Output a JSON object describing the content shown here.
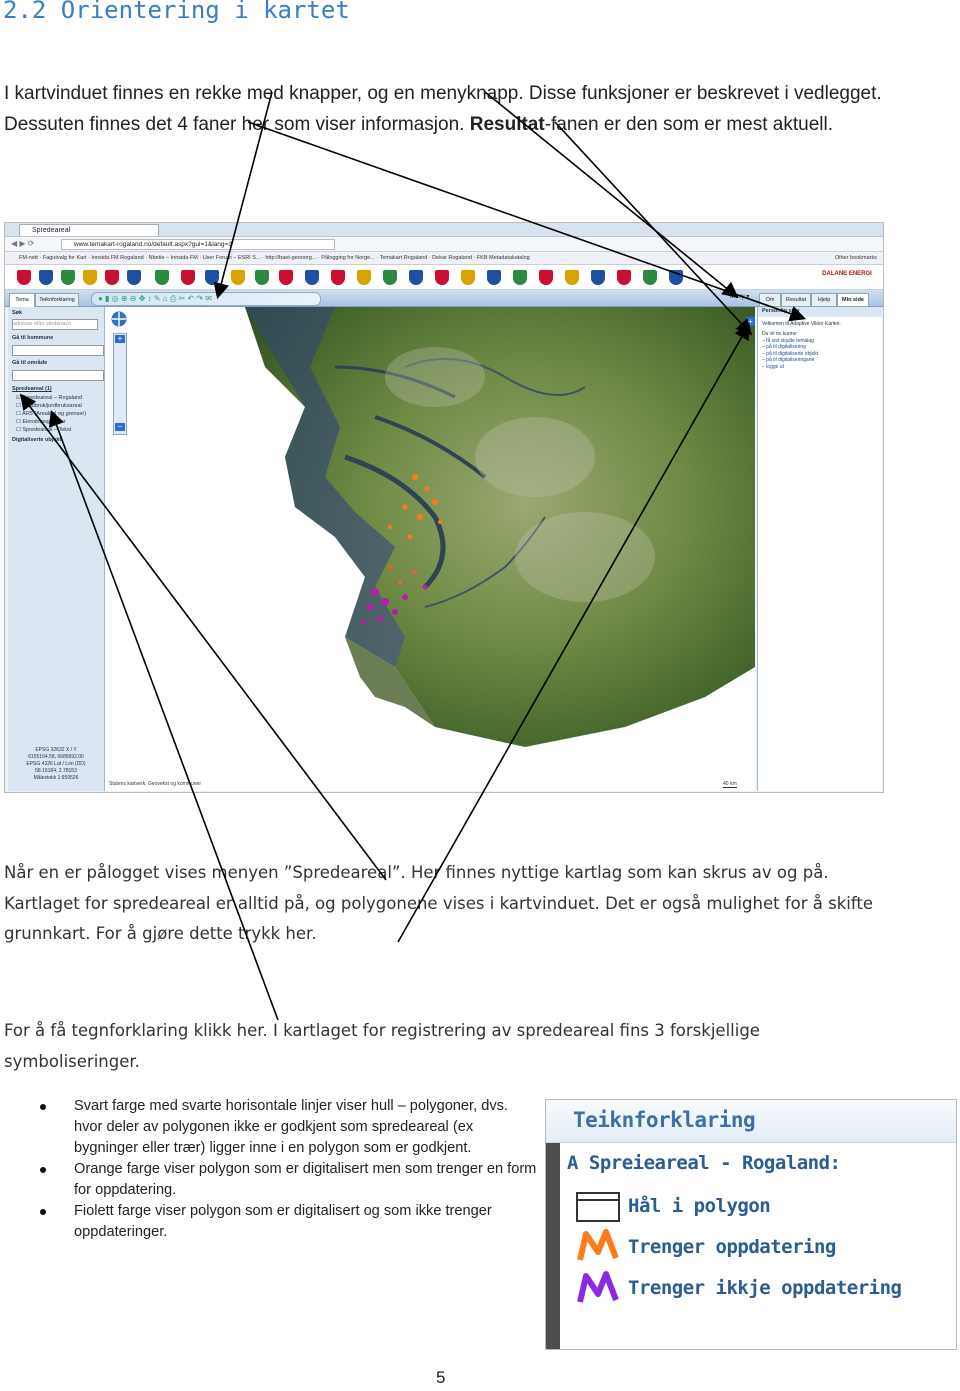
{
  "heading": "2.2 Orientering i kartet",
  "intro": {
    "part1": "I kartvinduet finnes en rekke med knapper, og en menyknapp. Disse funksjoner er beskrevet i vedlegget. Dessuten finnes det 4 faner her som viser informasjon. ",
    "bold": "Resultat",
    "part2": "-fanen er den som er mest aktuell."
  },
  "screenshot": {
    "tab_title": "Spredeareal",
    "url": "www.temakart-rogaland.no/default.aspx?gui=1&lang=3",
    "bookmarks": "FM-nett · Fagutvalg for Kart · Innsida FM Rogaland · Nbetie – Innsida FM · User Forum – ESRI S... · http://baet-geonorg... · Pålogging for Norge... · Temakart Rogaland · Dekar Rogaland · FKB Metadatakatalog",
    "other_bookmarks": "Other bookmarks",
    "left_tabs": [
      "Tema",
      "Teiknforklaring"
    ],
    "sidebar": {
      "search_label": "Søk",
      "search_placeholder": "adresse eller stedsnavn",
      "go_municipality": "Gå til kommune",
      "go_place": "Gå til område",
      "spreadarea_title": "Spredeareal (1)",
      "layers": [
        "Spredeareal – Rogaland",
        "Landbruk/jordbruksareal",
        "AR5 (Arealdel og grenser)",
        "Eiendomsgrenser",
        "Spredeareal – Tekst"
      ],
      "digitize": "Digitaliserte objekt",
      "coords": [
        "EPSG 32632 X / Y",
        "6155164.58, 6685692.00",
        "EPSG 4326 Lat / Lon (DD)",
        "58.16184, 2.78153",
        "Målestokk 1:959526"
      ]
    },
    "menu_label": "Meny ▾",
    "right_tabs": [
      "Om",
      "Resultat",
      "Hjelp",
      "Min side"
    ],
    "right_header": "Personlig side",
    "right_welcome": "Velkomen til Adaptive Viktor Karlen.",
    "right_items": [
      "Du vil no kunne:",
      "– få vist skjulte temalag",
      "– på til digitalisering",
      "– på til digitaliserte objekt",
      "– på til digitaliseringane",
      "– logge ut"
    ],
    "logo": "DALANE ENERGI",
    "map_credit": "Statens kartverk, Geovekst og kommuner",
    "scale_label": "40 km"
  },
  "para1": "Når en er pålogget vises menyen ”Spredeareal”. Her finnes nyttige kartlag som kan skrus av og på. Kartlaget for spredeareal er alltid på, og polygonene vises i kartvinduet. Det er også mulighet for å skifte grunnkart. For å gjøre dette trykk her.",
  "para2": "For å få tegnforklaring klikk her. I kartlaget for registrering av spredeareal fins 3 forskjellige symboliseringer.",
  "bullets": [
    "Svart farge med svarte horisontale linjer viser hull – polygoner, dvs. hvor deler av polygonen ikke er godkjent som spredeareal (ex bygninger eller trær) ligger inne i en polygon som er godkjent.",
    "Orange farge viser polygon som er digitalisert men som trenger en form for oppdatering.",
    "Fiolett farge viser polygon som er digitalisert og som ikke trenger oppdateringer."
  ],
  "legend": {
    "title": "Teiknforklaring",
    "subtitle": "A Spreieareal - Rogaland:",
    "rows": [
      "Hål i polygon",
      "Trenger oppdatering",
      "Trenger ikkje oppdatering"
    ],
    "colors": {
      "hole": "#333333",
      "orange": "#ff7a1a",
      "purple": "#8a2be2"
    }
  },
  "page_number": "5",
  "colors": {
    "heading": "#3b7dc4",
    "arrow": "#000000"
  }
}
